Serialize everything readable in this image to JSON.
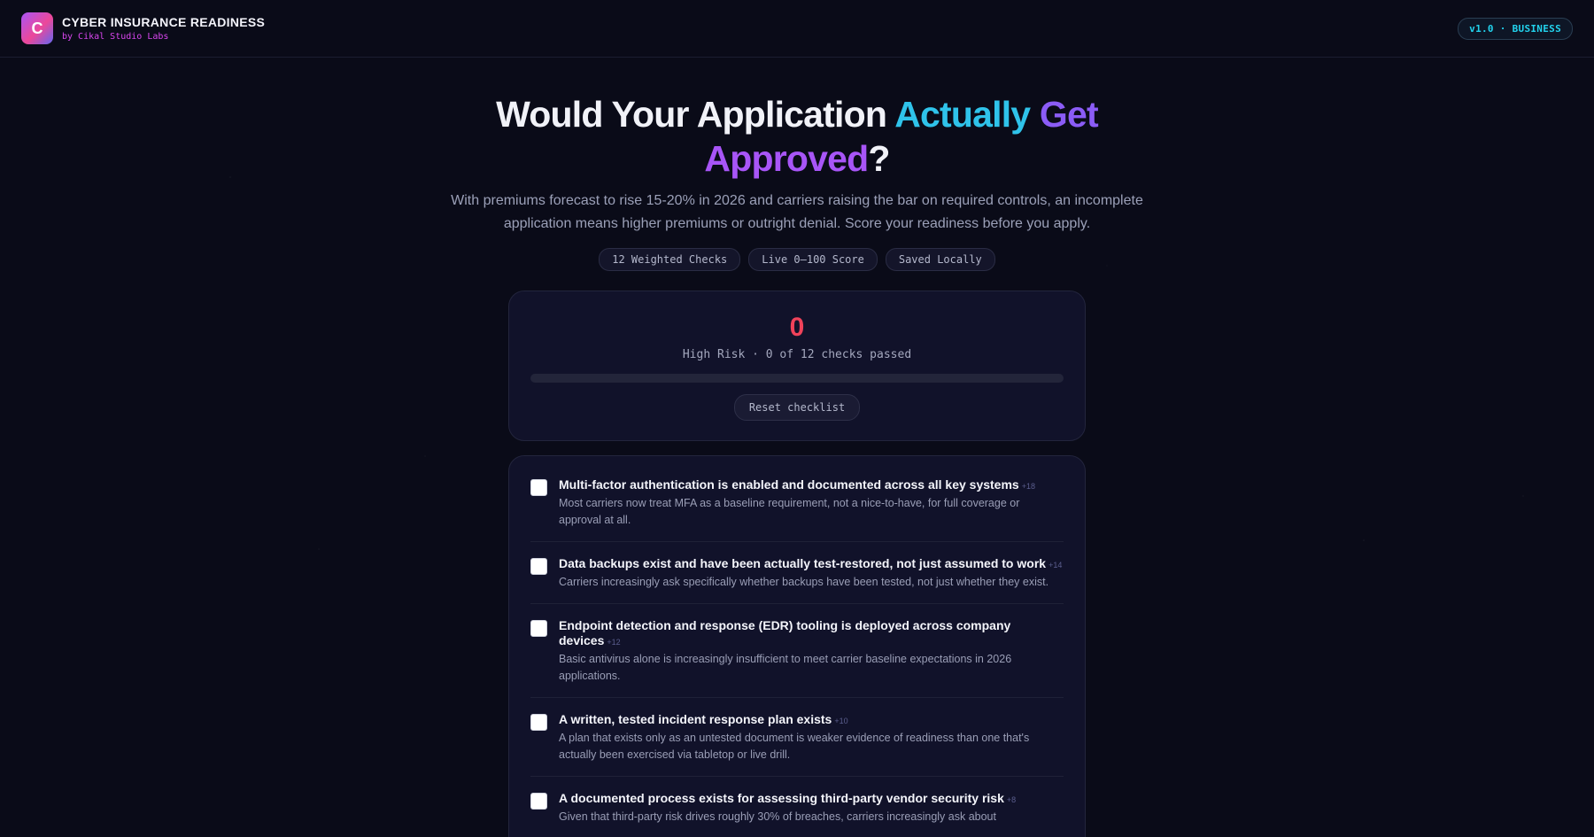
{
  "header": {
    "logo_letter": "C",
    "title": "CYBER INSURANCE READINESS",
    "subtitle": "by Cikal Studio Labs",
    "version": "v1.0 · BUSINESS"
  },
  "hero": {
    "headline_part1": "Would Your Application ",
    "headline_part2": "Actually",
    "headline_space": " ",
    "headline_part3": "Get",
    "headline_part4": "Approved",
    "headline_part5": "?",
    "subtext": "With premiums forecast to rise 15-20% in 2026 and carriers raising the bar on required controls, an incomplete application means higher premiums or outright denial. Score your readiness before you apply.",
    "pills": [
      "12 Weighted Checks",
      "Live 0–100 Score",
      "Saved Locally"
    ]
  },
  "score": {
    "value": "0",
    "status": "High Risk · 0 of 12 checks passed",
    "progress_fraction": 0,
    "reset_label": "Reset checklist",
    "color": "#f0425a"
  },
  "checklist": [
    {
      "title": "Multi-factor authentication is enabled and documented across all key systems",
      "weight": "+18",
      "desc": "Most carriers now treat MFA as a baseline requirement, not a nice-to-have, for full coverage or approval at all.",
      "checked": false
    },
    {
      "title": "Data backups exist and have been actually test-restored, not just assumed to work",
      "weight": "+14",
      "desc": "Carriers increasingly ask specifically whether backups have been tested, not just whether they exist.",
      "checked": false
    },
    {
      "title": "Endpoint detection and response (EDR) tooling is deployed across company devices",
      "weight": "+12",
      "desc": "Basic antivirus alone is increasingly insufficient to meet carrier baseline expectations in 2026 applications.",
      "checked": false
    },
    {
      "title": "A written, tested incident response plan exists",
      "weight": "+10",
      "desc": "A plan that exists only as an untested document is weaker evidence of readiness than one that's actually been exercised via tabletop or live drill.",
      "checked": false
    },
    {
      "title": "A documented process exists for assessing third-party vendor security risk",
      "weight": "+8",
      "desc": "Given that third-party risk drives roughly 30% of breaches, carriers increasingly ask about",
      "checked": false
    }
  ]
}
